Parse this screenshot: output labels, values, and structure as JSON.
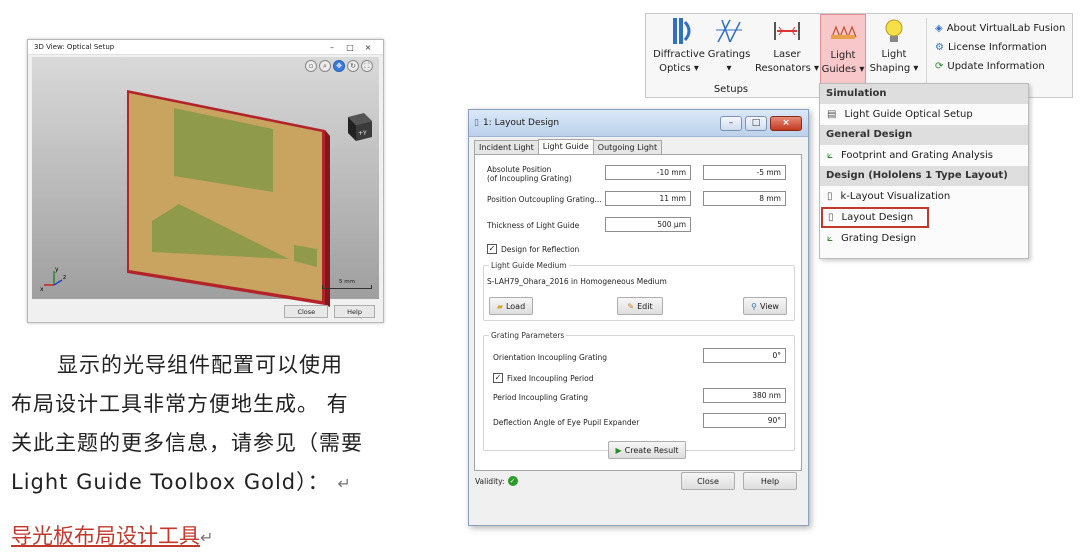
{
  "view3d": {
    "title": "3D View: Optical Setup",
    "controls": [
      "–",
      "□",
      "×"
    ],
    "scale_label": "5 mm",
    "close_label": "Close",
    "help_label": "Help",
    "axis_x": "x",
    "axis_y": "y",
    "axis_z": "z",
    "cube_label": "+Y",
    "plate_color": "#c8a460",
    "frame_color": "#b3242a",
    "grating_color": "#8f9b4a"
  },
  "text": {
    "line1": "显示的光导组件配置可以使用",
    "line2": "布局设计工具非常方便地生成。 有",
    "line3": "关此主题的更多信息，请参见（需要",
    "line4": "Light Guide Toolbox Gold）：",
    "return_mark": "↵",
    "link": "导光板布局设计工具"
  },
  "ribbon": {
    "buttons": [
      {
        "line1": "Diffractive",
        "line2": "Optics ▾"
      },
      {
        "line1": "Gratings",
        "line2": "▾"
      },
      {
        "line1": "Laser",
        "line2": "Resonators ▾"
      },
      {
        "line1": "Light",
        "line2": "Guides ▾"
      },
      {
        "line1": "Light",
        "line2": "Shaping ▾"
      }
    ],
    "group": "Setups",
    "info": [
      "About VirtualLab Fusion",
      "License Information",
      "Update Information"
    ],
    "active_color": "#f7c7c9"
  },
  "menu": {
    "sections": [
      {
        "header": "Simulation",
        "items": [
          "Light Guide Optical Setup"
        ]
      },
      {
        "header": "General Design",
        "items": [
          "Footprint and Grating Analysis"
        ]
      },
      {
        "header": "Design (Hololens 1 Type Layout)",
        "items": [
          "k-Layout Visualization",
          "Layout Design",
          "Grating Design"
        ]
      }
    ]
  },
  "dialog": {
    "title": "1: Layout Design",
    "tabs": [
      "Incident Light",
      "Light Guide",
      "Outgoing Light"
    ],
    "abs_pos_label1": "Absolute Position",
    "abs_pos_label2": "(of Incoupling Grating)",
    "abs_pos_x": "-10 mm",
    "abs_pos_y": "-5 mm",
    "pos_out_label": "Position Outcoupling Grating...",
    "pos_out_x": "11 mm",
    "pos_out_y": "8 mm",
    "thickness_label": "Thickness of Light Guide",
    "thickness_val": "500 µm",
    "reflection_label": "Design for Reflection",
    "medium_title": "Light Guide Medium",
    "medium_val": "S-LAH79_Ohara_2016 in Homogeneous Medium",
    "load_label": "Load",
    "edit_label": "Edit",
    "view_label": "View",
    "grating_title": "Grating Parameters",
    "orientation_label": "Orientation Incoupling Grating",
    "orientation_val": "0°",
    "fixed_label": "Fixed Incoupling Period",
    "period_label": "Period Incoupling Grating",
    "period_val": "380 nm",
    "deflection_label": "Deflection Angle of Eye Pupil Expander",
    "deflection_val": "90°",
    "create_label": "Create Result",
    "validity_label": "Validity:",
    "close_label": "Close",
    "help_label": "Help"
  }
}
